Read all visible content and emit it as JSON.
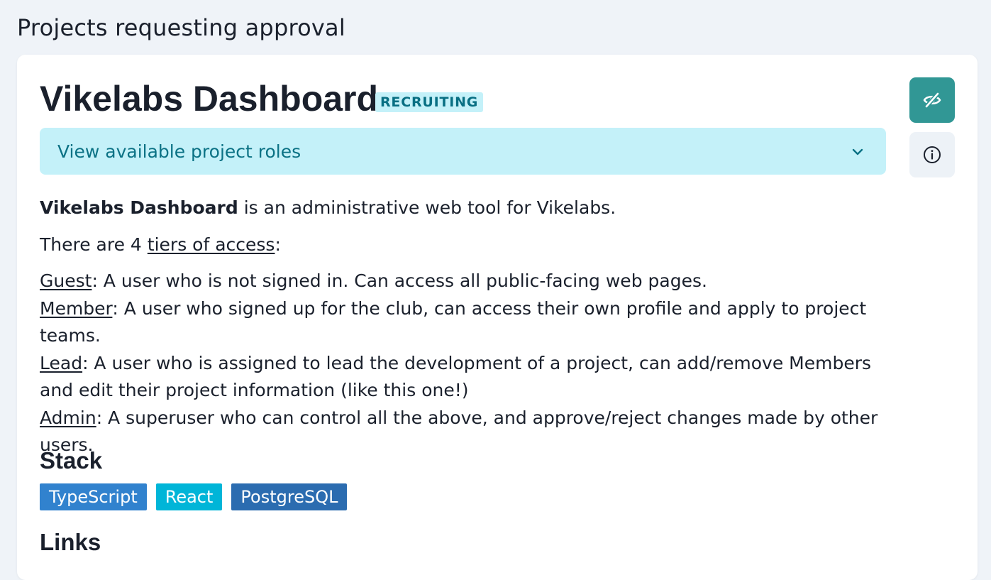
{
  "page": {
    "title": "Projects requesting approval"
  },
  "project": {
    "name": "Vikelabs Dashboard",
    "status": "RECRUITING",
    "roles_toggle_label": "View available project roles",
    "description": {
      "intro_bold": "Vikelabs Dashboard",
      "intro_rest": " is an administrative web tool for Vikelabs.",
      "tiers_prefix": "There are 4 ",
      "tiers_link": "tiers of access",
      "tiers_suffix": ":",
      "tiers": [
        {
          "name": "Guest",
          "text": ": A user who is not signed in. Can access all public-facing web pages."
        },
        {
          "name": "Member",
          "text": ": A user who signed up for the club, can access their own profile and apply to project teams."
        },
        {
          "name": "Lead",
          "text": ": A user who is assigned to lead the development of a project, can add/remove Members and edit their project information (like this one!)"
        },
        {
          "name": "Admin",
          "text": ": A superuser who can control all the above, and approve/reject changes made by other users."
        }
      ]
    },
    "stack_heading": "Stack",
    "stack": [
      {
        "label": "TypeScript",
        "color": "#3182ce"
      },
      {
        "label": "React",
        "color": "#00b5d8"
      },
      {
        "label": "PostgreSQL",
        "color": "#2b6cb0"
      }
    ],
    "links_heading": "Links"
  },
  "icons": {
    "hide": "eye-off-icon",
    "info": "info-icon",
    "chevron": "chevron-down-icon"
  },
  "colors": {
    "accent": "#319795",
    "badge_bg": "#c4f1f9",
    "badge_text": "#086f83"
  }
}
